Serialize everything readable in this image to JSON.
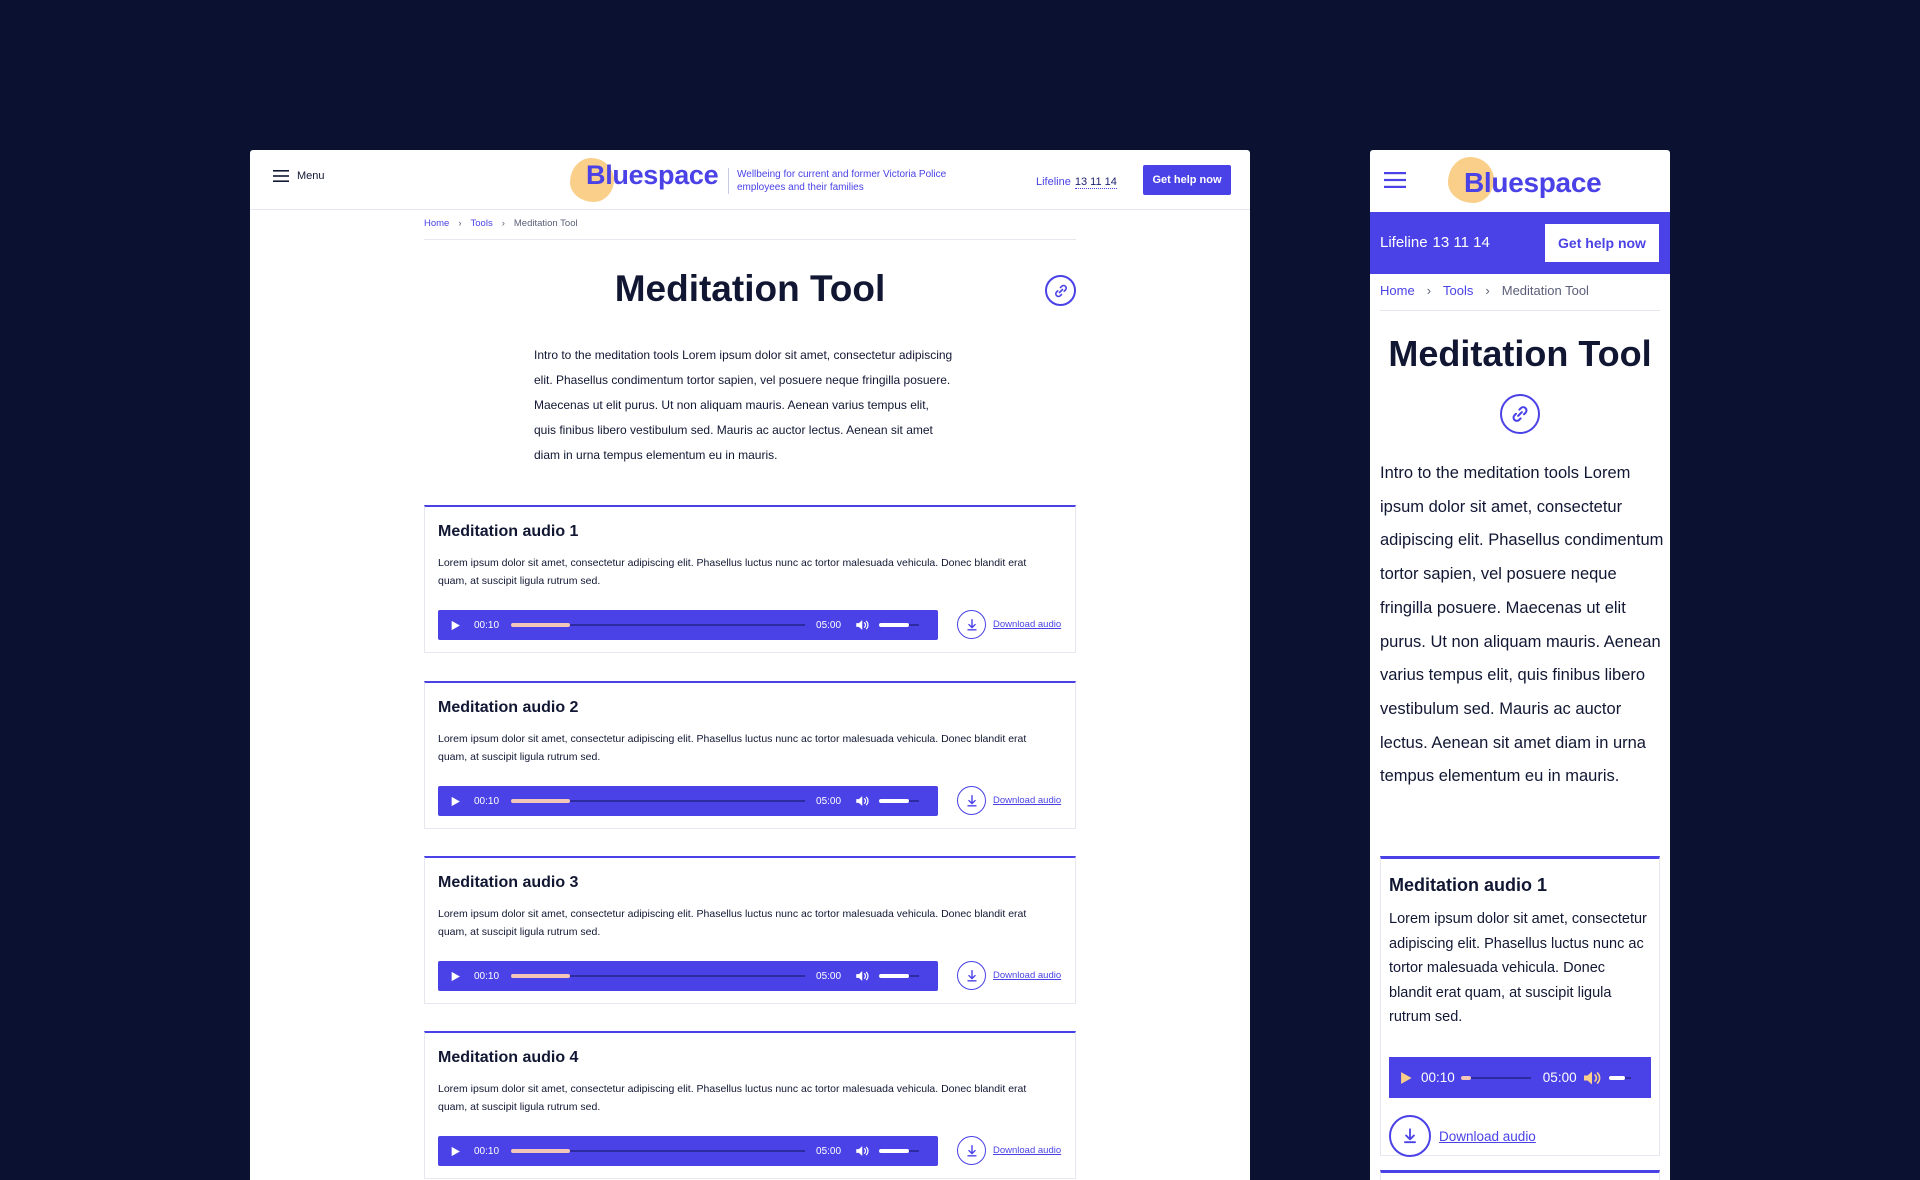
{
  "colors": {
    "background": "#0b1131",
    "accent": "#4a42e6",
    "logo_blob": "#f9cf8a",
    "progress": "#f2c6b8",
    "text": "#111733"
  },
  "brand": {
    "name": "Bluespace",
    "tagline": "Wellbeing for current and former Victoria Police employees and their families"
  },
  "header": {
    "menu_label": "Menu",
    "menu_icon": "hamburger-icon",
    "lifeline_label": "Lifeline",
    "lifeline_number": "13 11 14",
    "help_button": "Get help now"
  },
  "breadcrumb": [
    "Home",
    "Tools",
    "Meditation Tool"
  ],
  "page": {
    "title": "Meditation Tool",
    "share_icon": "link-icon",
    "intro": "Intro to the meditation tools Lorem ipsum dolor sit amet, consectetur adipiscing elit. Phasellus condimentum tortor sapien, vel posuere neque fringilla posuere. Maecenas ut elit purus. Ut non aliquam mauris. Aenean varius tempus elit, quis finibus libero vestibulum sed. Mauris ac auctor lectus. Aenean sit amet diam in urna tempus elementum eu in mauris."
  },
  "audio_items": [
    {
      "title": "Meditation audio 1",
      "description": "Lorem ipsum dolor sit amet, consectetur adipiscing elit. Phasellus luctus nunc ac tortor malesuada vehicula. Donec blandit erat quam, at suscipit ligula rutrum sed.",
      "current_time": "00:10",
      "duration": "05:00",
      "progress_pct": 20,
      "volume_pct": 75,
      "download_label": "Download audio"
    },
    {
      "title": "Meditation audio 2",
      "description": "Lorem ipsum dolor sit amet, consectetur adipiscing elit. Phasellus luctus nunc ac tortor malesuada vehicula. Donec blandit erat quam, at suscipit ligula rutrum sed.",
      "current_time": "00:10",
      "duration": "05:00",
      "progress_pct": 20,
      "volume_pct": 75,
      "download_label": "Download audio"
    },
    {
      "title": "Meditation audio 3",
      "description": "Lorem ipsum dolor sit amet, consectetur adipiscing elit. Phasellus luctus nunc ac tortor malesuada vehicula. Donec blandit erat quam, at suscipit ligula rutrum sed.",
      "current_time": "00:10",
      "duration": "05:00",
      "progress_pct": 20,
      "volume_pct": 75,
      "download_label": "Download audio"
    },
    {
      "title": "Meditation audio 4",
      "description": "Lorem ipsum dolor sit amet, consectetur adipiscing elit. Phasellus luctus nunc ac tortor malesuada vehicula. Donec blandit erat quam, at suscipit ligula rutrum sed.",
      "current_time": "00:10",
      "duration": "05:00",
      "progress_pct": 20,
      "volume_pct": 75,
      "download_label": "Download audio"
    }
  ],
  "mobile": {
    "audio_items_visible": 1,
    "progress_pct": 15,
    "volume_pct": 75
  }
}
